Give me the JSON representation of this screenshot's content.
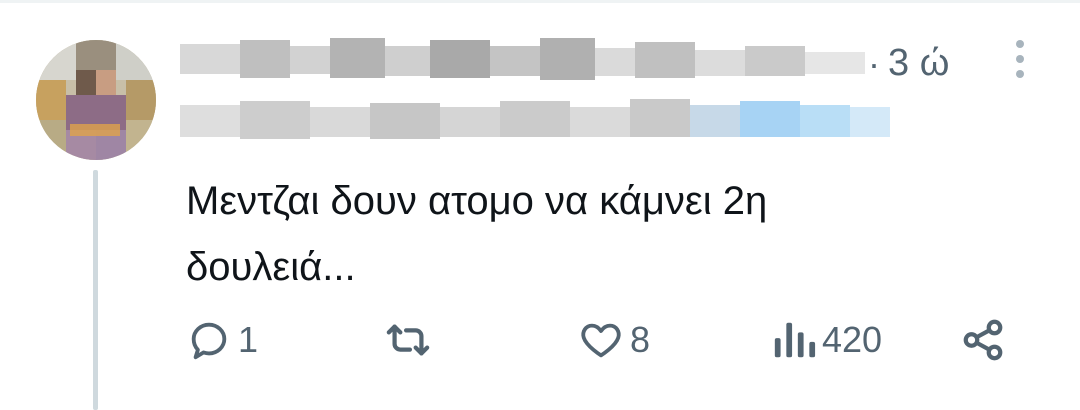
{
  "tweet": {
    "time_sep": "·",
    "time": "3 ώ",
    "text_line1": "Μεντζαι δουν ατομο να κάμνει 2η",
    "text_line2": "δουλειά..."
  },
  "actions": {
    "reply_icon": "reply-icon",
    "reply_count": "1",
    "retweet_icon": "retweet-icon",
    "like_icon": "heart-icon",
    "like_count": "8",
    "views_icon": "views-bar-chart-icon",
    "views_count": "420",
    "share_icon": "share-icon"
  },
  "colors": {
    "text_primary": "#0f1419",
    "text_secondary": "#536471",
    "thread_line": "#cfd9de",
    "mention_blue": "#1d9bf0"
  }
}
